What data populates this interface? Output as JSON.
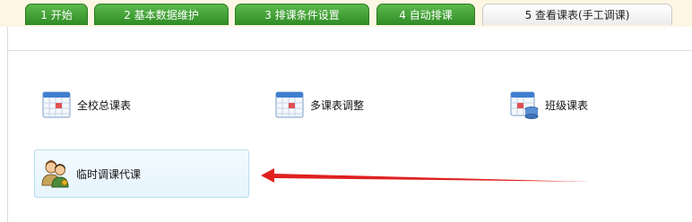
{
  "tabs": [
    {
      "label": "1 开始",
      "active": false
    },
    {
      "label": "2 基本数据维护",
      "active": false
    },
    {
      "label": "3 排课条件设置",
      "active": false
    },
    {
      "label": "4 自动排课",
      "active": false
    },
    {
      "label": "5 查看课表(手工调课)",
      "active": true
    }
  ],
  "items": {
    "school_schedule": {
      "label": "全校总课表",
      "icon": "calendar-icon"
    },
    "multi_adjust": {
      "label": "多课表调整",
      "icon": "calendar-icon"
    },
    "class_schedule": {
      "label": "班级课表",
      "icon": "calendar-stack-icon"
    },
    "substitute": {
      "label": "临时调课代课",
      "icon": "users-icon"
    }
  },
  "colors": {
    "tab_green": "#3c9a32",
    "arrow_red": "#e02020",
    "selected_bg": "#e6f4fc"
  }
}
